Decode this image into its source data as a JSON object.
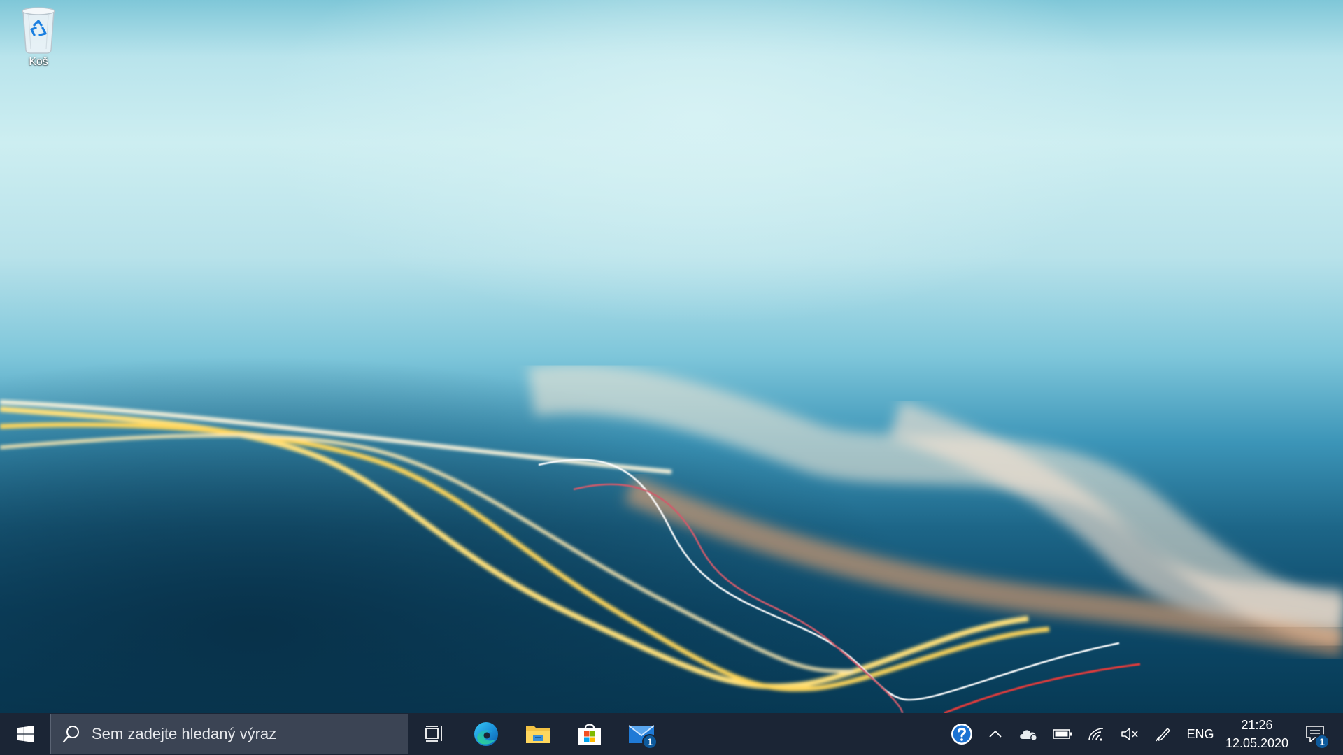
{
  "desktop": {
    "icons": [
      {
        "label": "Koš",
        "icon": "recycle-bin-icon"
      }
    ]
  },
  "taskbar": {
    "start": {
      "icon": "windows-logo-icon"
    },
    "search": {
      "placeholder": "Sem zadejte hledaný výraz",
      "icon": "search-icon"
    },
    "task_view": {
      "icon": "task-view-icon"
    },
    "pinned_apps": [
      {
        "name": "Microsoft Edge",
        "icon": "edge-icon"
      },
      {
        "name": "File Explorer",
        "icon": "folder-icon"
      },
      {
        "name": "Microsoft Store",
        "icon": "store-icon"
      },
      {
        "name": "Mail",
        "icon": "mail-icon",
        "badge": "1"
      }
    ],
    "tray": {
      "icons": [
        "help-icon",
        "chevron-up-icon",
        "onedrive-icon",
        "battery-icon",
        "wifi-icon",
        "volume-muted-icon",
        "pen-icon"
      ],
      "language": "ENG",
      "time": "21:26",
      "date": "12.05.2020",
      "notifications_badge": "1"
    }
  },
  "colors": {
    "taskbar_bg": "#1b2535",
    "search_bg": "#3b4454",
    "accent": "#0e5a9c"
  }
}
